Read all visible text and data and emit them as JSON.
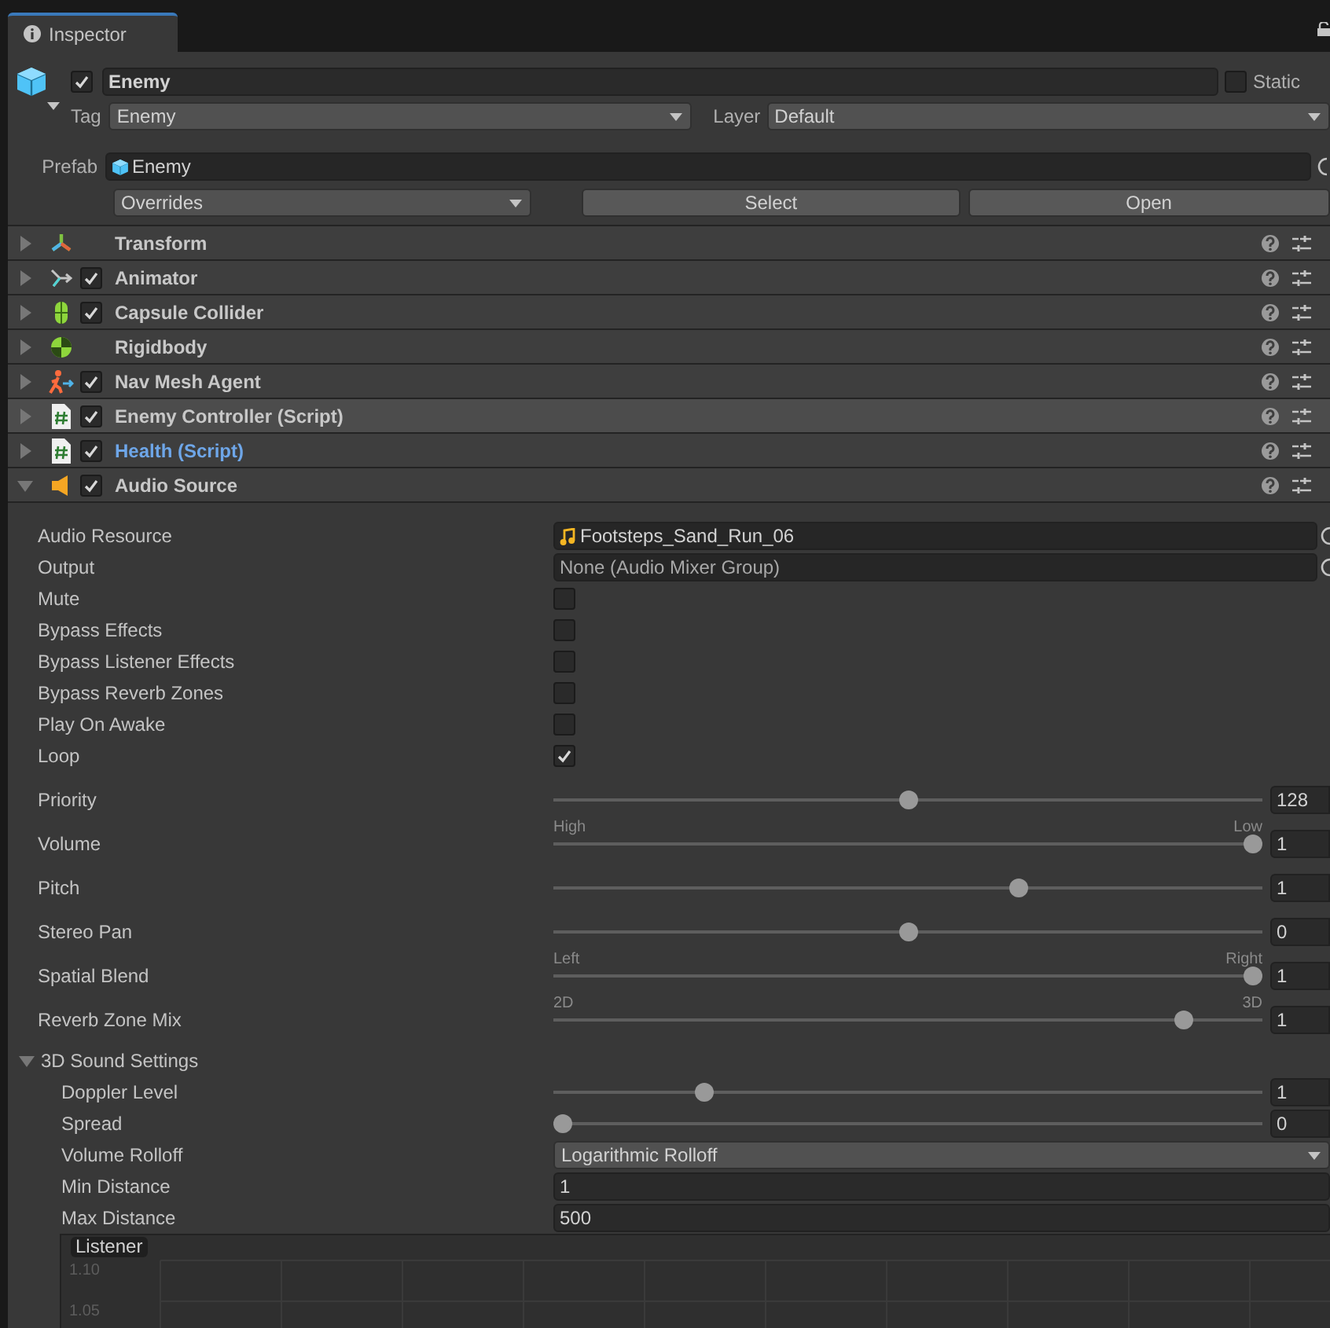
{
  "tab": {
    "label": "Inspector",
    "selected": true
  },
  "object": {
    "active": true,
    "name": "Enemy",
    "static_label": "Static",
    "static": false,
    "tag_label": "Tag",
    "tag": "Enemy",
    "layer_label": "Layer",
    "layer": "Default"
  },
  "prefab": {
    "label": "Prefab",
    "asset": "Enemy",
    "overrides": "Overrides",
    "buttons": [
      "Select",
      "Open"
    ]
  },
  "components": [
    {
      "kind": "transform",
      "name": "Transform",
      "expanded": false,
      "hovered": false,
      "overridden": false
    },
    {
      "kind": "animator",
      "name": "Animator",
      "enabled": true,
      "expanded": false,
      "hovered": false,
      "overridden": false
    },
    {
      "kind": "capsule_collider",
      "name": "Capsule Collider",
      "enabled": true,
      "expanded": false,
      "hovered": false,
      "overridden": false
    },
    {
      "kind": "rigidbody",
      "name": "Rigidbody",
      "expanded": false,
      "hovered": false,
      "overridden": false
    },
    {
      "kind": "nav_mesh_agent",
      "name": "Nav Mesh Agent",
      "enabled": true,
      "expanded": false,
      "hovered": false,
      "overridden": false
    },
    {
      "kind": "script",
      "name": "Enemy Controller (Script)",
      "enabled": true,
      "expanded": false,
      "hovered": true,
      "overridden": false
    },
    {
      "kind": "script",
      "name": "Health (Script)",
      "enabled": true,
      "expanded": false,
      "hovered": false,
      "overridden": true
    },
    {
      "kind": "audio_source",
      "name": "Audio Source",
      "enabled": true,
      "expanded": true,
      "hovered": false,
      "overridden": false
    }
  ],
  "audio_source": {
    "properties": [
      {
        "kind": "audio_clip",
        "label": "Audio Resource",
        "value": "Footsteps_Sand_Run_06"
      },
      {
        "kind": "object",
        "label": "Output",
        "value": "None (Audio Mixer Group)"
      },
      {
        "kind": "checkbox",
        "label": "Mute",
        "checked": false
      },
      {
        "kind": "checkbox",
        "label": "Bypass Effects",
        "checked": false
      },
      {
        "kind": "checkbox",
        "label": "Bypass Listener Effects",
        "checked": false
      },
      {
        "kind": "checkbox",
        "label": "Bypass Reverb Zones",
        "checked": false
      },
      {
        "kind": "checkbox",
        "label": "Play On Awake",
        "checked": false
      },
      {
        "kind": "checkbox",
        "label": "Loop",
        "checked": true
      },
      {
        "kind": "slider",
        "label": "Priority",
        "level": 0.5,
        "value": "128",
        "min_label": "High",
        "max_label": "Low"
      },
      {
        "kind": "slider",
        "label": "Volume",
        "level": 1,
        "value": "1"
      },
      {
        "kind": "slider",
        "label": "Pitch",
        "level": 0.66,
        "value": "1"
      },
      {
        "kind": "slider",
        "label": "Stereo Pan",
        "level": 0.5,
        "value": "0",
        "min_label": "Left",
        "max_label": "Right"
      },
      {
        "kind": "slider",
        "label": "Spatial Blend",
        "level": 1,
        "value": "1",
        "min_label": "2D",
        "max_label": "3D"
      },
      {
        "kind": "slider",
        "label": "Reverb Zone Mix",
        "level": 0.9,
        "value": "1"
      }
    ],
    "sound_3d": {
      "label": "3D Sound Settings",
      "expanded": true,
      "properties": [
        {
          "kind": "slider",
          "label": "Doppler Level",
          "level": 0.206,
          "value": "1"
        },
        {
          "kind": "slider",
          "label": "Spread",
          "level": 0,
          "value": "0"
        },
        {
          "kind": "dropdown",
          "label": "Volume Rolloff",
          "value": "Logarithmic Rolloff"
        },
        {
          "kind": "field",
          "label": "Min Distance",
          "value": "1"
        },
        {
          "kind": "field",
          "label": "Max Distance",
          "value": "500"
        }
      ]
    },
    "graph": {
      "label": "Listener",
      "y_labels": [
        "1.10",
        "1.05"
      ]
    }
  }
}
